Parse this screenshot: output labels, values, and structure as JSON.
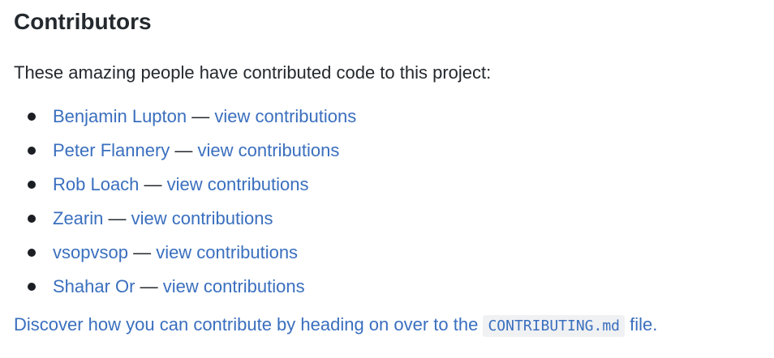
{
  "section": {
    "title": "Contributors",
    "intro": "These amazing people have contributed code to this project:"
  },
  "contributors": [
    {
      "name": "Benjamin Lupton",
      "separator": " — ",
      "link": "view contributions"
    },
    {
      "name": "Peter Flannery",
      "separator": " — ",
      "link": "view contributions"
    },
    {
      "name": "Rob Loach",
      "separator": " — ",
      "link": "view contributions"
    },
    {
      "name": "Zearin",
      "separator": " — ",
      "link": "view contributions"
    },
    {
      "name": "vsopvsop",
      "separator": " — ",
      "link": "view contributions"
    },
    {
      "name": "Shahar Or",
      "separator": " — ",
      "link": "view contributions"
    }
  ],
  "discover": {
    "text_before": "Discover how you can contribute by heading on over to the ",
    "file": "CONTRIBUTING.md",
    "text_after": " file."
  },
  "colors": {
    "link": "#3a6fbe",
    "text": "#24292e",
    "code_bg": "#f0f1f3"
  }
}
